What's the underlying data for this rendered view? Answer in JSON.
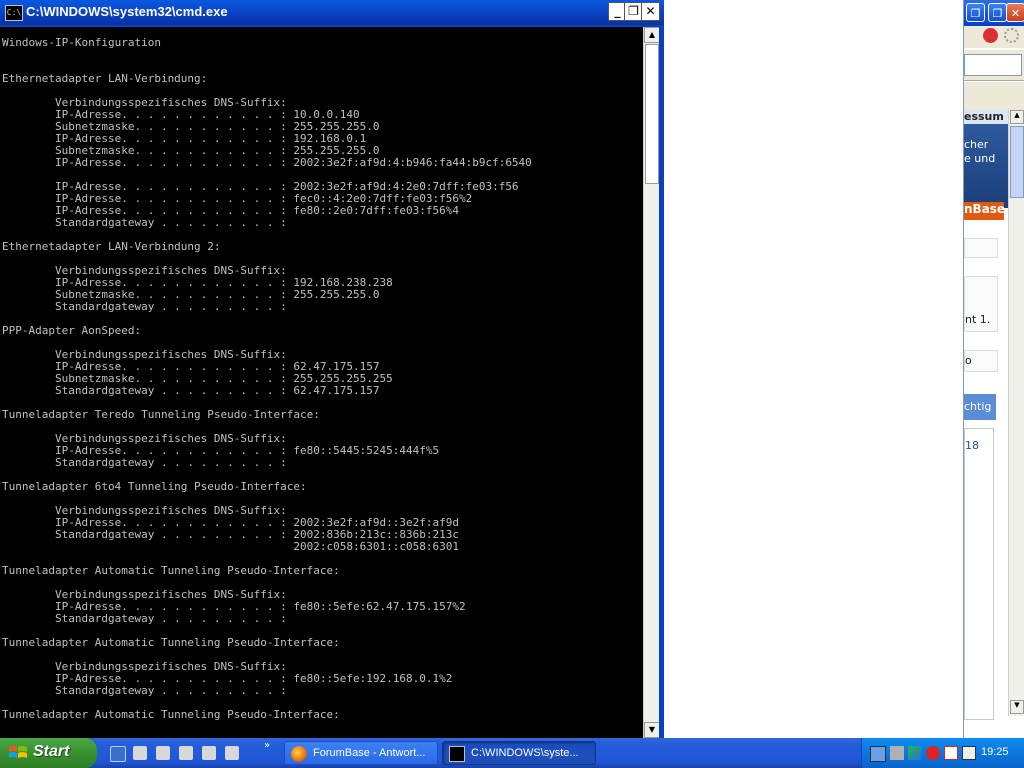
{
  "browser_background": {
    "fragment_impressum": "essum",
    "fragment_cher": "cher",
    "fragment_eund": "e und",
    "fragment_nbase": "nBase",
    "fragment_nt1": "nt 1.",
    "fragment_chtig": "chtig",
    "fragment_18": "18",
    "fragment_o": "o"
  },
  "cmd": {
    "title": "C:\\WINDOWS\\system32\\cmd.exe",
    "icon_label": "C:\\",
    "buttons": {
      "minimize": "_",
      "restore": "❐",
      "close": "✕"
    },
    "console_lines": [
      "Windows-IP-Konfiguration",
      "",
      "",
      "Ethernetadapter LAN-Verbindung:",
      "",
      "        Verbindungsspezifisches DNS-Suffix:",
      "        IP-Adresse. . . . . . . . . . . . : 10.0.0.140",
      "        Subnetzmaske. . . . . . . . . . . : 255.255.255.0",
      "        IP-Adresse. . . . . . . . . . . . : 192.168.0.1",
      "        Subnetzmaske. . . . . . . . . . . : 255.255.255.0",
      "        IP-Adresse. . . . . . . . . . . . : 2002:3e2f:af9d:4:b946:fa44:b9cf:6540",
      "",
      "        IP-Adresse. . . . . . . . . . . . : 2002:3e2f:af9d:4:2e0:7dff:fe03:f56",
      "        IP-Adresse. . . . . . . . . . . . : fec0::4:2e0:7dff:fe03:f56%2",
      "        IP-Adresse. . . . . . . . . . . . : fe80::2e0:7dff:fe03:f56%4",
      "        Standardgateway . . . . . . . . . :",
      "",
      "Ethernetadapter LAN-Verbindung 2:",
      "",
      "        Verbindungsspezifisches DNS-Suffix:",
      "        IP-Adresse. . . . . . . . . . . . : 192.168.238.238",
      "        Subnetzmaske. . . . . . . . . . . : 255.255.255.0",
      "        Standardgateway . . . . . . . . . :",
      "",
      "PPP-Adapter AonSpeed:",
      "",
      "        Verbindungsspezifisches DNS-Suffix:",
      "        IP-Adresse. . . . . . . . . . . . : 62.47.175.157",
      "        Subnetzmaske. . . . . . . . . . . : 255.255.255.255",
      "        Standardgateway . . . . . . . . . : 62.47.175.157",
      "",
      "Tunneladapter Teredo Tunneling Pseudo-Interface:",
      "",
      "        Verbindungsspezifisches DNS-Suffix:",
      "        IP-Adresse. . . . . . . . . . . . : fe80::5445:5245:444f%5",
      "        Standardgateway . . . . . . . . . :",
      "",
      "Tunneladapter 6to4 Tunneling Pseudo-Interface:",
      "",
      "        Verbindungsspezifisches DNS-Suffix:",
      "        IP-Adresse. . . . . . . . . . . . : 2002:3e2f:af9d::3e2f:af9d",
      "        Standardgateway . . . . . . . . . : 2002:836b:213c::836b:213c",
      "                                            2002:c058:6301::c058:6301",
      "",
      "Tunneladapter Automatic Tunneling Pseudo-Interface:",
      "",
      "        Verbindungsspezifisches DNS-Suffix:",
      "        IP-Adresse. . . . . . . . . . . . : fe80::5efe:62.47.175.157%2",
      "        Standardgateway . . . . . . . . . :",
      "",
      "Tunneladapter Automatic Tunneling Pseudo-Interface:",
      "",
      "        Verbindungsspezifisches DNS-Suffix:",
      "        IP-Adresse. . . . . . . . . . . . : fe80::5efe:192.168.0.1%2",
      "        Standardgateway . . . . . . . . . :",
      "",
      "Tunneladapter Automatic Tunneling Pseudo-Interface:"
    ]
  },
  "taskbar": {
    "start_label": "Start",
    "quicklaunch_more": "»",
    "tasks": [
      {
        "label": "ForumBase - Antwort...",
        "icon": "firefox-icon",
        "active": false
      },
      {
        "label": "C:\\WINDOWS\\syste...",
        "icon": "cmd-icon",
        "active": true
      }
    ],
    "clock": "19:25"
  },
  "colors": {
    "console_bg": "#000000",
    "console_fg": "#c0c0c0",
    "titlebar": "#0a3fbf",
    "taskbar": "#245edb",
    "start": "#38912f",
    "tray": "#0b77de"
  }
}
